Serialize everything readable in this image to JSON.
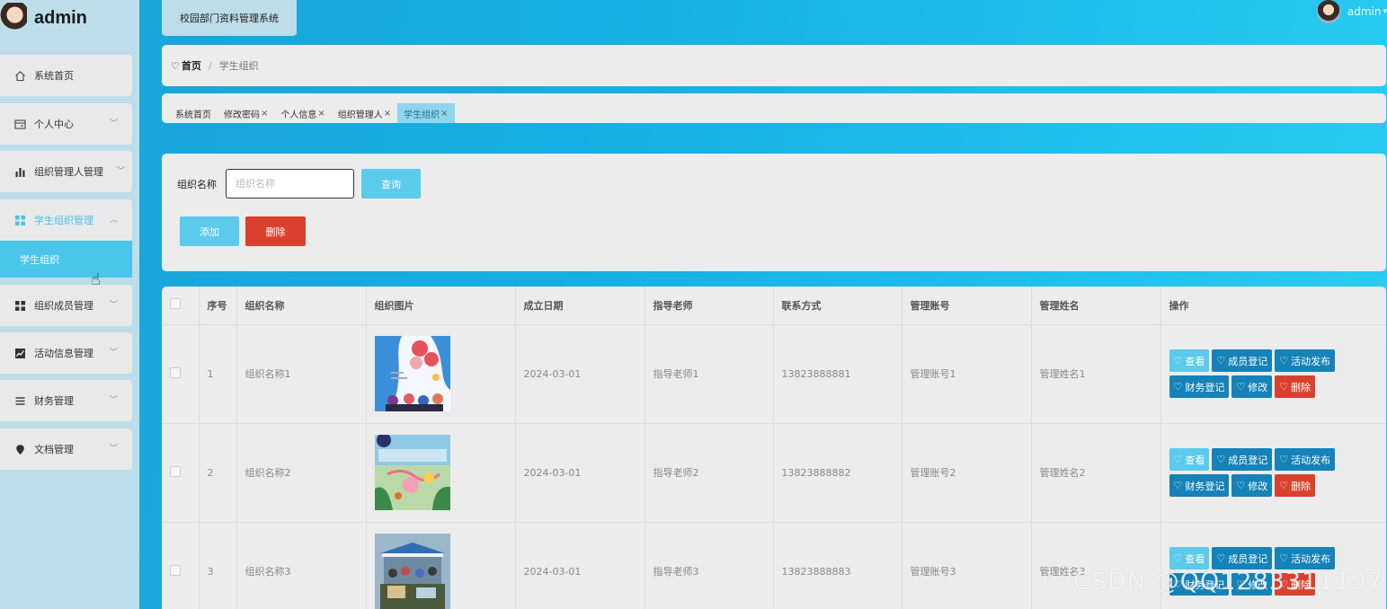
{
  "brand": {
    "title": "admin"
  },
  "header": {
    "system_title": "校园部门资料管理系统",
    "user_name": "admin"
  },
  "sidebar": {
    "items": [
      {
        "label": "系统首页",
        "icon": "home-icon"
      },
      {
        "label": "个人中心",
        "icon": "panel-icon"
      },
      {
        "label": "组织管理人管理",
        "icon": "bar-chart-icon"
      },
      {
        "label": "学生组织管理",
        "icon": "grid-icon",
        "open": true
      },
      {
        "label": "组织成员管理",
        "icon": "grid-icon"
      },
      {
        "label": "活动信息管理",
        "icon": "line-chart-icon"
      },
      {
        "label": "财务管理",
        "icon": "list-icon"
      },
      {
        "label": "文档管理",
        "icon": "location-icon"
      }
    ],
    "submenu": {
      "label": "学生组织"
    }
  },
  "breadcrumb": {
    "home": "首页",
    "separator": "/",
    "current": "学生组织"
  },
  "tags": [
    {
      "label": "系统首页",
      "closable": false
    },
    {
      "label": "修改密码",
      "closable": true
    },
    {
      "label": "个人信息",
      "closable": true
    },
    {
      "label": "组织管理人",
      "closable": true
    },
    {
      "label": "学生组织",
      "closable": true,
      "active": true
    }
  ],
  "search": {
    "label": "组织名称",
    "placeholder": "组织名称",
    "value": "",
    "query_label": "查询",
    "add_label": "添加",
    "delete_label": "删除"
  },
  "table": {
    "columns": [
      "",
      "序号",
      "组织名称",
      "组织图片",
      "成立日期",
      "指导老师",
      "联系方式",
      "管理账号",
      "管理姓名",
      "操作"
    ],
    "rows": [
      {
        "index": "1",
        "name": "组织名称1",
        "image": "poster-club-recruitment",
        "date": "2024-03-01",
        "teacher": "指导老师1",
        "phone": "13823888881",
        "account": "管理账号1",
        "manager": "管理姓名1"
      },
      {
        "index": "2",
        "name": "组织名称2",
        "image": "poster-dance-club",
        "date": "2024-03-01",
        "teacher": "指导老师2",
        "phone": "13823888882",
        "account": "管理账号2",
        "manager": "管理姓名2"
      },
      {
        "index": "3",
        "name": "组织名称3",
        "image": "photo-campus-booth",
        "date": "2024-03-01",
        "teacher": "指导老师3",
        "phone": "13823888883",
        "account": "管理账号3",
        "manager": "管理姓名3"
      }
    ],
    "actions": {
      "view": "查看",
      "member_register": "成员登记",
      "activity_publish": "活动发布",
      "finance_register": "财务登记",
      "edit": "修改",
      "delete": "删除"
    }
  },
  "colors": {
    "accent": "#5ccaea",
    "action_blue": "#1582b8",
    "danger": "#d9412e",
    "sidebar_bg": "#bcdde9",
    "panel_bg": "#ececec"
  },
  "watermark": "CSDN @QQ1283311197"
}
